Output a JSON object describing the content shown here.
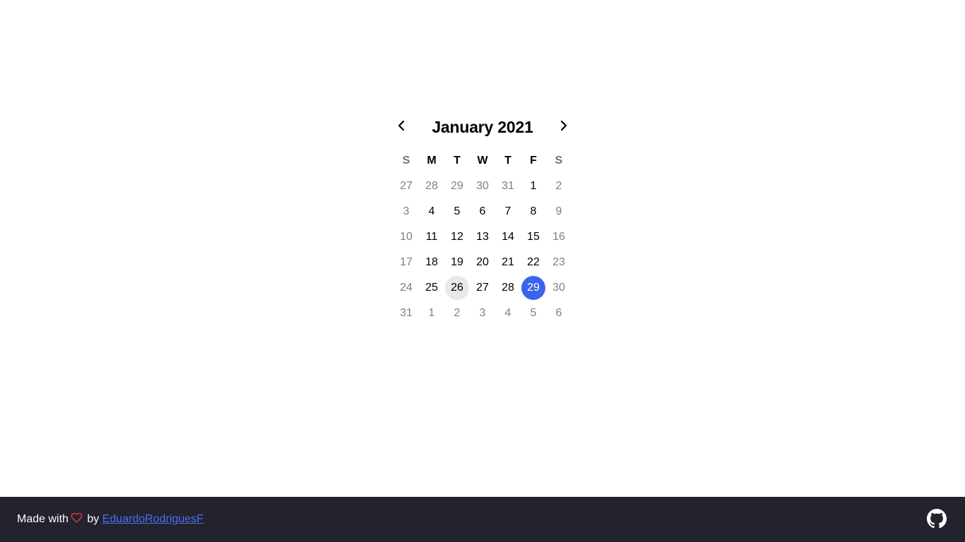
{
  "calendar": {
    "title": "January 2021",
    "prev_icon": "chevron-left-icon",
    "next_icon": "chevron-right-icon",
    "weekdays": [
      {
        "label": "S",
        "weekend": true
      },
      {
        "label": "M",
        "weekend": false
      },
      {
        "label": "T",
        "weekend": false
      },
      {
        "label": "W",
        "weekend": false
      },
      {
        "label": "T",
        "weekend": false
      },
      {
        "label": "F",
        "weekend": false
      },
      {
        "label": "S",
        "weekend": true
      }
    ],
    "weeks": [
      [
        {
          "d": "27",
          "m": true
        },
        {
          "d": "28",
          "m": true
        },
        {
          "d": "29",
          "m": true
        },
        {
          "d": "30",
          "m": true
        },
        {
          "d": "31",
          "m": true
        },
        {
          "d": "1",
          "m": false
        },
        {
          "d": "2",
          "m": true
        }
      ],
      [
        {
          "d": "3",
          "m": true
        },
        {
          "d": "4",
          "m": false
        },
        {
          "d": "5",
          "m": false
        },
        {
          "d": "6",
          "m": false
        },
        {
          "d": "7",
          "m": false
        },
        {
          "d": "8",
          "m": false
        },
        {
          "d": "9",
          "m": true
        }
      ],
      [
        {
          "d": "10",
          "m": true
        },
        {
          "d": "11",
          "m": false
        },
        {
          "d": "12",
          "m": false
        },
        {
          "d": "13",
          "m": false
        },
        {
          "d": "14",
          "m": false
        },
        {
          "d": "15",
          "m": false
        },
        {
          "d": "16",
          "m": true
        }
      ],
      [
        {
          "d": "17",
          "m": true
        },
        {
          "d": "18",
          "m": false
        },
        {
          "d": "19",
          "m": false
        },
        {
          "d": "20",
          "m": false
        },
        {
          "d": "21",
          "m": false
        },
        {
          "d": "22",
          "m": false
        },
        {
          "d": "23",
          "m": true
        }
      ],
      [
        {
          "d": "24",
          "m": true
        },
        {
          "d": "25",
          "m": false
        },
        {
          "d": "26",
          "m": false,
          "today": true
        },
        {
          "d": "27",
          "m": false
        },
        {
          "d": "28",
          "m": false
        },
        {
          "d": "29",
          "m": false,
          "selected": true
        },
        {
          "d": "30",
          "m": true
        }
      ],
      [
        {
          "d": "31",
          "m": true
        },
        {
          "d": "1",
          "m": true
        },
        {
          "d": "2",
          "m": true
        },
        {
          "d": "3",
          "m": true
        },
        {
          "d": "4",
          "m": true
        },
        {
          "d": "5",
          "m": true
        },
        {
          "d": "6",
          "m": true
        }
      ]
    ],
    "colors": {
      "selected_bg": "#3b63ec",
      "today_bg": "#e8e8e8",
      "muted_text": "#808080"
    }
  },
  "footer": {
    "made_with": "Made with",
    "heart_icon": "heart-icon",
    "by": "by",
    "author_link": "EduardoRodriguesF",
    "github_icon": "github-icon",
    "colors": {
      "background": "#22232c",
      "link": "#4f6df5",
      "heart": "#e0333a"
    }
  }
}
